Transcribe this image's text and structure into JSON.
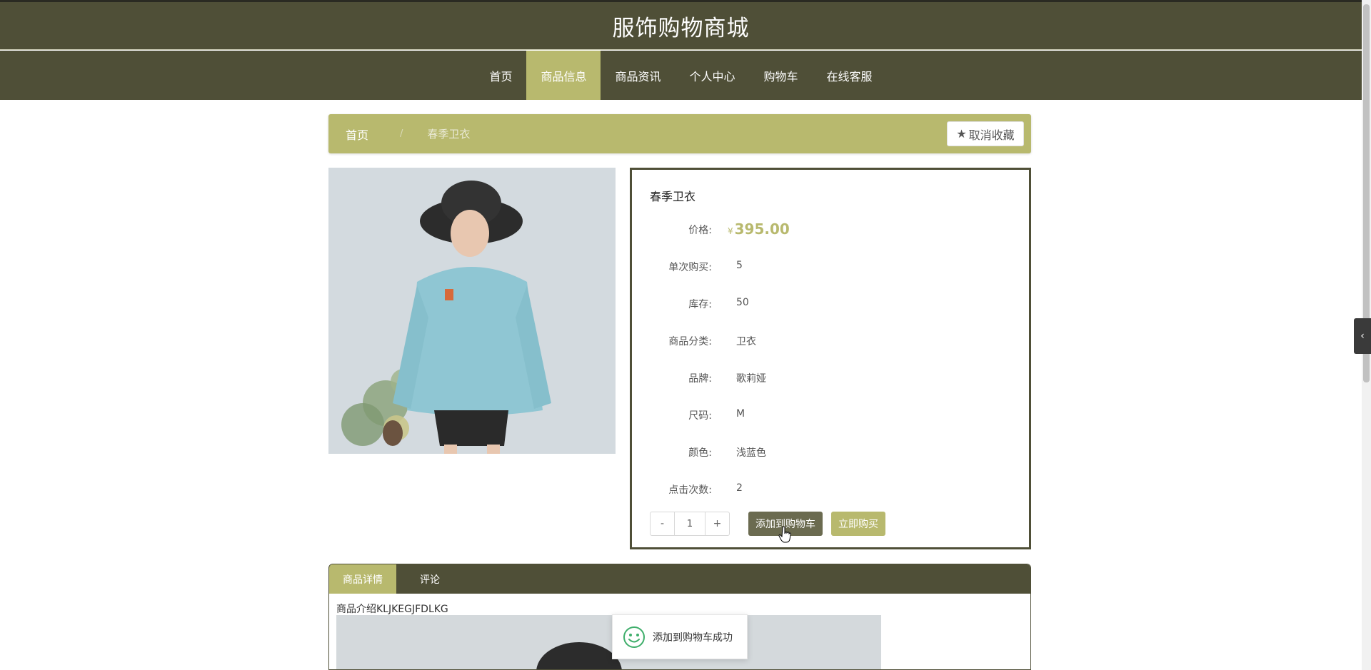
{
  "site": {
    "title": "服饰购物商城"
  },
  "nav": {
    "items": [
      {
        "label": "首页",
        "active": false
      },
      {
        "label": "商品信息",
        "active": true
      },
      {
        "label": "商品资讯",
        "active": false
      },
      {
        "label": "个人中心",
        "active": false
      },
      {
        "label": "购物车",
        "active": false
      },
      {
        "label": "在线客服",
        "active": false
      }
    ]
  },
  "breadcrumb": {
    "home": "首页",
    "separator": "/",
    "current": "春季卫衣",
    "favorite_label": "取消收藏"
  },
  "product": {
    "name": "春季卫衣",
    "price_label": "价格:",
    "currency": "¥",
    "price": "395.00",
    "fields": [
      {
        "label": "单次购买:",
        "value": "5"
      },
      {
        "label": "库存:",
        "value": "50"
      },
      {
        "label": "商品分类:",
        "value": "卫衣"
      },
      {
        "label": "品牌:",
        "value": "歌莉娅"
      },
      {
        "label": "尺码:",
        "value": "M"
      },
      {
        "label": "颜色:",
        "value": "浅蓝色"
      },
      {
        "label": "点击次数:",
        "value": "2"
      }
    ],
    "quantity": {
      "minus": "-",
      "value": "1",
      "plus": "+"
    },
    "add_to_cart_label": "添加到购物车",
    "buy_now_label": "立即购买"
  },
  "tabs": {
    "items": [
      {
        "label": "商品详情",
        "active": true
      },
      {
        "label": "评论",
        "active": false
      }
    ]
  },
  "detail": {
    "intro": "商品介绍KLJKEGJFDLKG"
  },
  "toast": {
    "message": "添加到购物车成功"
  },
  "side_toggle": {
    "icon": "‹"
  },
  "colors": {
    "header": "#4f4f37",
    "accent": "#b8b96e",
    "cart_button": "#6b6b50"
  }
}
